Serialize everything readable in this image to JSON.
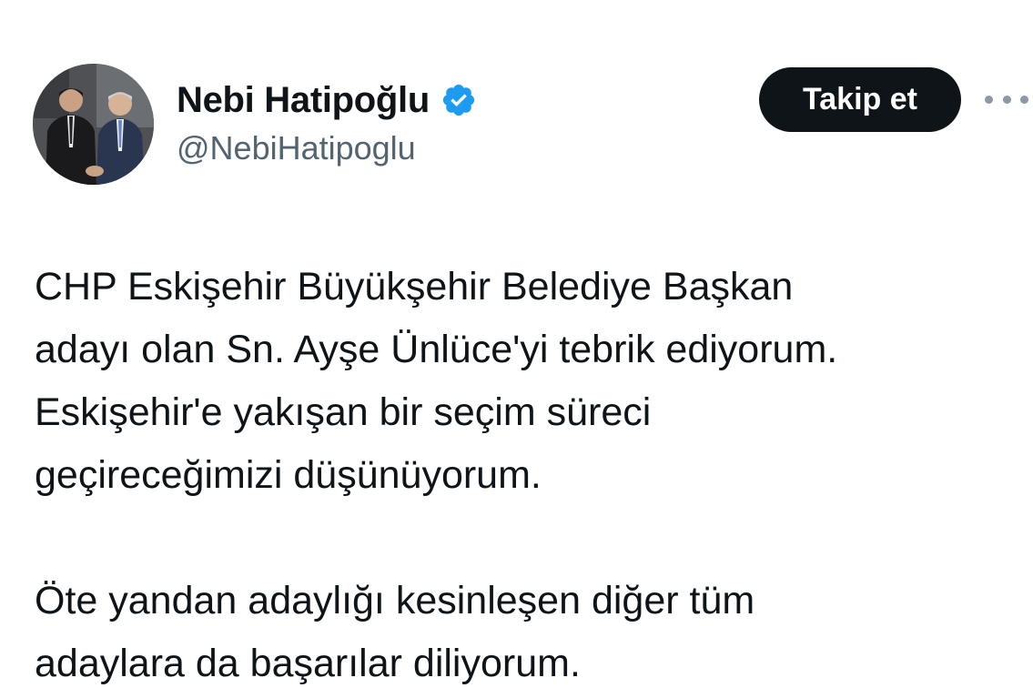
{
  "author": {
    "display_name": "Nebi Hatipoğlu",
    "handle": "@NebiHatipoglu",
    "verified": true,
    "verified_color": "#1d9bf0",
    "avatar_icon": "profile-photo"
  },
  "actions": {
    "follow_label": "Takip et",
    "more_icon": "more-horizontal-icon"
  },
  "tweet": {
    "paragraphs": [
      "CHP Eskişehir Büyükşehir Belediye Başkan\nadayı olan Sn. Ayşe Ünlüce'yi tebrik ediyorum.\nEskişehir'e yakışan bir seçim süreci\ngeçireceğimizi düşünüyorum.",
      "Öte yandan adaylığı kesinleşen diğer tüm\nadaylara da başarılar diliyorum."
    ]
  },
  "colors": {
    "text_primary": "#0f1419",
    "text_secondary": "#536471",
    "button_bg": "#0f1419",
    "button_text": "#ffffff",
    "background": "#ffffff"
  }
}
